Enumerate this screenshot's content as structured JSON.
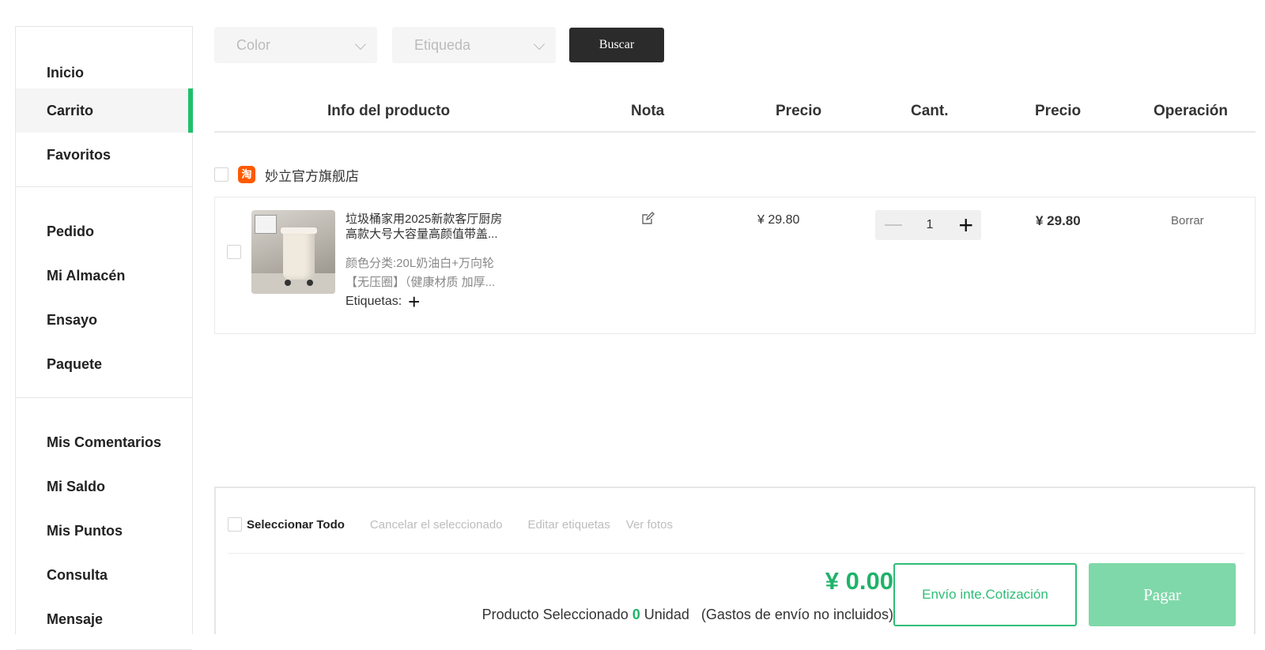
{
  "sidebar": {
    "group1": [
      {
        "label": "Inicio"
      },
      {
        "label": "Carrito",
        "active": true
      },
      {
        "label": "Favoritos"
      }
    ],
    "group2": [
      {
        "label": "Pedido"
      },
      {
        "label": "Mi Almacén"
      },
      {
        "label": "Ensayo"
      },
      {
        "label": "Paquete"
      }
    ],
    "group3": [
      {
        "label": "Mis Comentarios"
      },
      {
        "label": "Mi Saldo"
      },
      {
        "label": "Mis Puntos"
      },
      {
        "label": "Consulta"
      },
      {
        "label": "Mensaje"
      }
    ]
  },
  "filters": {
    "color_placeholder": "Color",
    "tag_placeholder": "Etiqueda",
    "search_label": "Buscar"
  },
  "table_header": {
    "product_info": "Info del producto",
    "note": "Nota",
    "price": "Precio",
    "qty": "Cant.",
    "total_price": "Precio",
    "operation": "Operación"
  },
  "store": {
    "icon_text": "淘",
    "name": "妙立官方旗舰店"
  },
  "item": {
    "title_line1": "垃圾桶家用2025新款客厅厨房",
    "title_line2": "高款大号大容量高颜值带盖...",
    "spec_line1": "颜色分类:20L奶油白+万向轮",
    "spec_line2": "【无压圈】（健康材质 加厚...",
    "tags_label": "Etiquetas:",
    "price": "¥ 29.80",
    "quantity": "1",
    "subtotal": "¥ 29.80",
    "delete_label": "Borrar"
  },
  "footer": {
    "select_all": "Seleccionar Todo",
    "cancel_selected": "Cancelar el seleccionado",
    "edit_tags": "Editar etiquetas",
    "view_photos": "Ver fotos",
    "total": "¥ 0.00",
    "selected_prefix": "Producto Seleccionado",
    "selected_count": "0",
    "selected_unit": "Unidad",
    "shipping_note": "(Gastos de envío no incluidos)",
    "quote_button": "Envío inte.Cotización",
    "pay_button": "Pagar"
  },
  "colors": {
    "accent": "#1fc06a",
    "pay_button": "#7fd8a9",
    "search_button": "#2b2b2b"
  },
  "icons": [
    "chevron-down-icon",
    "note-edit-icon",
    "minus-icon",
    "plus-icon",
    "store-badge-icon"
  ]
}
